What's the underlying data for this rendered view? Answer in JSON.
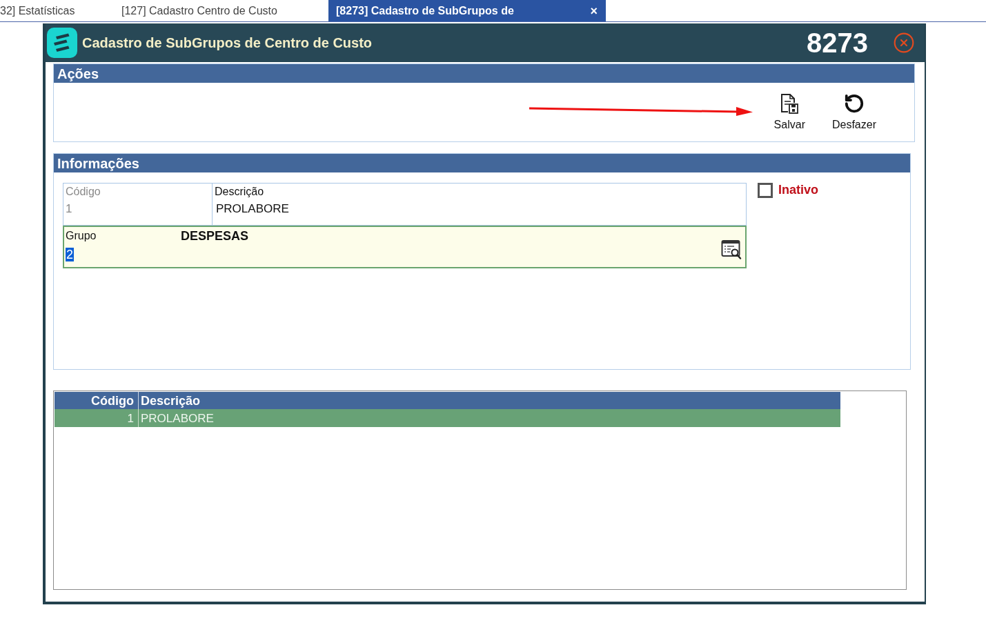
{
  "tabs": [
    {
      "label": "32] Estatísticas",
      "selected": false
    },
    {
      "label": "[127] Cadastro Centro de Custo",
      "selected": false
    },
    {
      "label": "[8273] Cadastro de SubGrupos de",
      "selected": true,
      "close": "×"
    }
  ],
  "window": {
    "title": "Cadastro de SubGrupos de Centro de Custo",
    "code": "8273"
  },
  "actions": {
    "title": "Ações",
    "buttons": [
      {
        "kind": "save",
        "label": "Salvar"
      },
      {
        "kind": "undo",
        "label": "Desfazer"
      }
    ]
  },
  "info": {
    "title": "Informações",
    "fields": [
      {
        "label": "Código",
        "value": "1",
        "disabled": true
      },
      {
        "label": "Descrição",
        "value": "PROLABORE",
        "disabled": false
      }
    ],
    "group": {
      "label": "Grupo",
      "description": "DESPESAS",
      "value": "2",
      "selected": true
    },
    "inactive": {
      "label": "Inativo",
      "checked": false
    }
  },
  "grid": {
    "columns": [
      "Código",
      "Descrição"
    ],
    "rows": [
      {
        "cells": [
          "1",
          "PROLABORE"
        ],
        "selected": true
      }
    ]
  }
}
